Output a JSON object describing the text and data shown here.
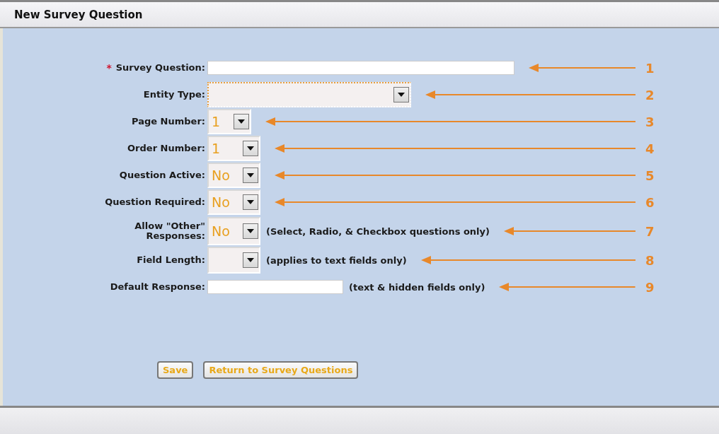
{
  "header": {
    "title": "New Survey Question"
  },
  "fields": [
    {
      "label": "Survey Question:",
      "marker": "*",
      "kind": "text",
      "focused": false,
      "callout": "1"
    },
    {
      "label": "Entity Type:",
      "kind": "select",
      "focused": true,
      "callout": "2"
    },
    {
      "label": "Page Number:",
      "kind": "select",
      "value": "1",
      "focused": false,
      "callout": "3"
    },
    {
      "label": "Order Number:",
      "kind": "select",
      "value": "1",
      "focused": false,
      "callout": "4"
    },
    {
      "label": "Question Active:",
      "kind": "select",
      "value": "No",
      "focused": false,
      "callout": "5"
    },
    {
      "label": "Question Required:",
      "kind": "select",
      "value": "No",
      "focused": false,
      "callout": "6"
    },
    {
      "label": "Allow \"Other\" Responses:",
      "kind": "select",
      "value": "No",
      "focused": false,
      "note": "(Select, Radio, & Checkbox questions only)",
      "callout": "7"
    },
    {
      "label": "Field Length:",
      "kind": "select",
      "focused": false,
      "note": "(applies to text fields only)",
      "callout": "8"
    },
    {
      "label": "Default Response:",
      "kind": "text",
      "focused": false,
      "note": "(text & hidden fields only)",
      "callout": "9"
    }
  ],
  "buttons": [
    "Save",
    "Return to Survey Questions"
  ]
}
